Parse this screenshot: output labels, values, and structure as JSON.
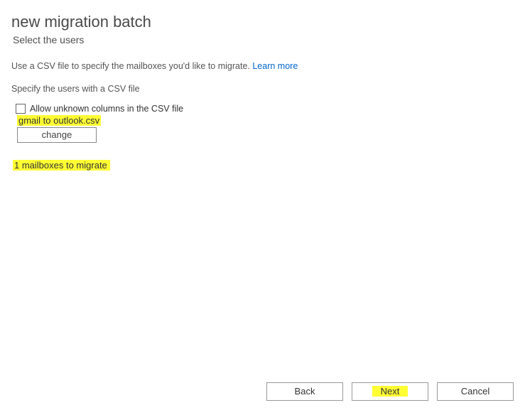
{
  "header": {
    "title": "new migration batch",
    "subtitle": "Select the users"
  },
  "description": {
    "text": "Use a CSV file to specify the mailboxes you'd like to migrate.",
    "link": "Learn more"
  },
  "specify_label": "Specify the users with a CSV file",
  "checkbox": {
    "label": "Allow unknown columns in the CSV file",
    "checked": false
  },
  "file": {
    "name": "gmail to outlook.csv",
    "change_label": "change"
  },
  "summary": "1 mailboxes to migrate",
  "footer": {
    "back": "Back",
    "next": "Next",
    "cancel": "Cancel"
  }
}
